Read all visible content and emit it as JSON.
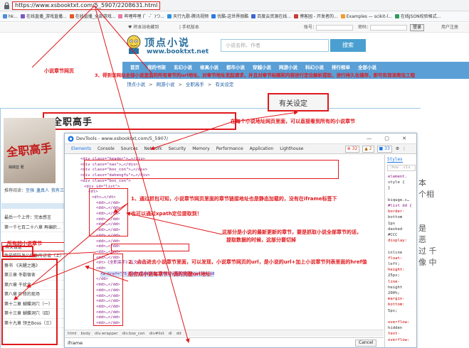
{
  "browser": {
    "url": "https://www.xsbooktxt.com/5_5907/2208631.html",
    "bookmarks": [
      "hk...",
      "在线直播_游戏直播...",
      "在线直播_全部游戏...",
      "哔哩哔哩 (゜-゜)つ...",
      "天行九歌-腾讯视频",
      "优酷-这世界很酷",
      "百度云资源在线...",
      "博客园 - 开发者的...",
      "Examples — scikit-l...",
      "在线JSON校验格式..."
    ],
    "bookmark_colors": [
      "#4a8fd8",
      "#7b58c9",
      "#e6572b",
      "#e97aa4",
      "#2b8fe2",
      "#2c7be5",
      "#3a66d8",
      "#c93a3a",
      "#f59b2f",
      "#2e9d5c"
    ]
  },
  "site": {
    "top": {
      "favorite": "♥ 将本站收藏到",
      "mobile": "| 手机版本",
      "account_label": "账号：",
      "password_label": "密码：",
      "login_button": "登录",
      "user_center": "用户注册"
    },
    "logo_title": "顶点小说",
    "logo_url": "www.booktxt.net",
    "search_placeholder": "小说名称、作者",
    "search_button": "搜索",
    "nav": [
      "首页",
      "我的书架",
      "玄幻小说",
      "修真小说",
      "都市小说",
      "穿越小说",
      "网游小说",
      "科幻小说",
      "排行榜单",
      "全部小说"
    ],
    "breadcrumb": [
      "顶点小说",
      ">",
      "网游小说",
      ">",
      "全职高手",
      ">",
      "有关设定"
    ],
    "book_title": "全职高手",
    "cover_title": "全职高手",
    "cover_subtitle": "蝴蝶蓝 著",
    "tags_label": "推荐阅读：",
    "tags": [
      "至强",
      "蛊真人",
      "我有三"
    ],
    "chapter_list": [
      "最后一个上传：完本感言",
      "第一千七百二十八章 再编织... ",
      "所有的小说章节",
      "有关设定",
      "致最唯陆发公媒体所访谈（上）",
      "蔡书 《天醒之路》",
      "第三章 冬歇宿舍",
      "第六章 干扰伞",
      "第八章 叶修的现场",
      "第十二章 蝴蝶洞穴（一）",
      "第十三章 蝴蝶洞穴（四）",
      "第十九章 领主Boss（三）"
    ],
    "all_chapters_label": "所有的小说章节",
    "about": "有关设定",
    "right_cjk": [
      "本",
      "个相",
      "",
      "",
      "是",
      "恶",
      "过 千",
      "像 中"
    ]
  },
  "devtools": {
    "title": "DevTools - www.xsbooktxt.com/5_5907/",
    "tabs": [
      "Elements",
      "Console",
      "Sources",
      "Network",
      "Security",
      "Memory",
      "Performance",
      "Application",
      "Lighthouse"
    ],
    "active_tab": "Elements",
    "counts": {
      "errors": "32",
      "warnings": "2",
      "info": "33"
    },
    "code": [
      "<div class=\"header\">…</div>",
      "<div class=\"nav\">…</div>",
      "<div class=\"box_con\">…</div>",
      "<div class=\"dahengfu\">…</div>",
      "<div class=\"box_con\">",
      "<div id=\"list\">",
      "<dl>",
      "<dt>…</dt>",
      "<dd>…</dd>",
      "<dd>…</dd>",
      "<dd>…</dd>",
      "<dd>…</dd>",
      "<dd>…</dd>",
      "<dd>…</dd>",
      "<dd>…</dd>",
      "<dd>…</dd>",
      "<dd>…</dd>",
      "<dd>…</dd>",
      "<dd>…</dd>",
      "<dt>《全职高手》正文</dt>",
      "<dd>",
      "<a href=\"/5_5907/2208631.html\">有关设定</a> == $0",
      "</dd>",
      "<dd>…</dd>",
      "<dd>…</dd>",
      "<dd>…</dd>",
      "<dd>…</dd>",
      "<dd>…</dd>",
      "<dd>…</dd>",
      "<dd>…</dd>",
      "<dd>…</dd>"
    ],
    "breadcrumb": [
      "html",
      "body",
      "div.wrapper",
      "div.box_con",
      "div#list",
      "dl",
      "dd"
    ],
    "search_query": "iframe",
    "search_cancel": "Cancel",
    "styles_tab": "Styles",
    "styles_filter": ":hov .cls",
    "styles_lines": [
      "element.",
      "style {",
      "}",
      "",
      "biquge.c…",
      "#list dd {",
      "  border-",
      "  bottom",
      "    1px",
      "    dashed",
      "    #CCC",
      "  display:",
      "",
      "    inline",
      "  float:",
      "    left;",
      "  height:",
      "    25px;",
      "  line-",
      "    height",
      "    200%;",
      "  margin-",
      "    bottom:",
      "    5px;",
      "",
      "overflow:",
      "  hidden",
      "  text-",
      "    overflow:"
    ]
  },
  "annotations": {
    "chapter_page": "小说章节网页",
    "step3": "3、得到该网站全部小说里面的所有章节的url地址，对章节地址发起请求，并且对章节标题和内容进行定位解析提取，进行持久化储存，即可实现该爬虫工程",
    "in_page": "在每个小说地址网页里面，可以直接看到所有的小说章节",
    "step1_line1": "1、通过抓包可知，小说章节网页里面的章节链接地址也是静态加载的，没有在iframe标签下",
    "step1_line2": "也可以通过xpath定位提取到！",
    "latest_line1": "这部分是小说的最新更新的章节，要是抓取小说全部章节的话，",
    "latest_line2": "提取数据的时候，这部分要切掉",
    "step2_line1": "2、点击进去小说章节里面，可以发现，小说章节网页的url，是小说的url+加上小说章节列表里面的href值",
    "step2_line2": "组合成小说每章节小说的完整url地址"
  }
}
